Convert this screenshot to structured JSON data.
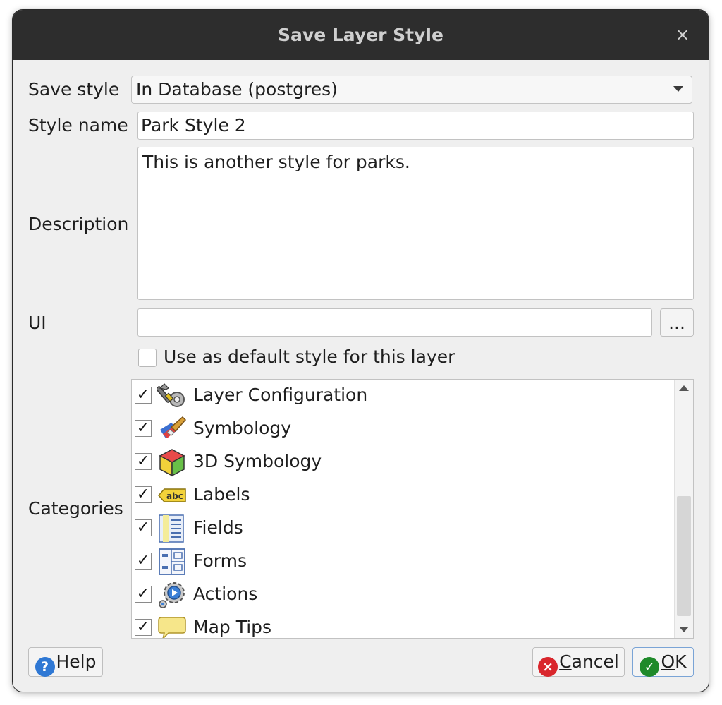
{
  "dialog": {
    "title": "Save Layer Style",
    "close_glyph": "×"
  },
  "form": {
    "save_style_label": "Save style",
    "save_style_value": "In Database (postgres)",
    "style_name_label": "Style name",
    "style_name_value": "Park Style 2",
    "description_label": "Description",
    "description_value": "This is another style for parks.",
    "ui_label": "UI",
    "ui_value": "",
    "browse_label": "...",
    "default_style_label": "Use as default style for this layer",
    "default_style_checked": false,
    "categories_label": "Categories"
  },
  "categories": [
    {
      "label": "Layer Configuration",
      "checked": true,
      "icon": "layer-configuration-icon"
    },
    {
      "label": "Symbology",
      "checked": true,
      "icon": "symbology-icon"
    },
    {
      "label": "3D Symbology",
      "checked": true,
      "icon": "3d-symbology-icon"
    },
    {
      "label": "Labels",
      "checked": true,
      "icon": "labels-icon"
    },
    {
      "label": "Fields",
      "checked": true,
      "icon": "fields-icon"
    },
    {
      "label": "Forms",
      "checked": true,
      "icon": "forms-icon"
    },
    {
      "label": "Actions",
      "checked": true,
      "icon": "actions-icon"
    },
    {
      "label": "Map Tips",
      "checked": true,
      "icon": "map-tips-icon"
    }
  ],
  "buttons": {
    "help": "Help",
    "cancel_underline": "C",
    "cancel_rest": "ancel",
    "ok_underline": "O",
    "ok_rest": "K"
  },
  "colors": {
    "titlebar": "#2d2d2d",
    "ok_icon": "#1f8a2a",
    "cancel_icon": "#d9262c",
    "help_icon": "#2f78d4"
  }
}
